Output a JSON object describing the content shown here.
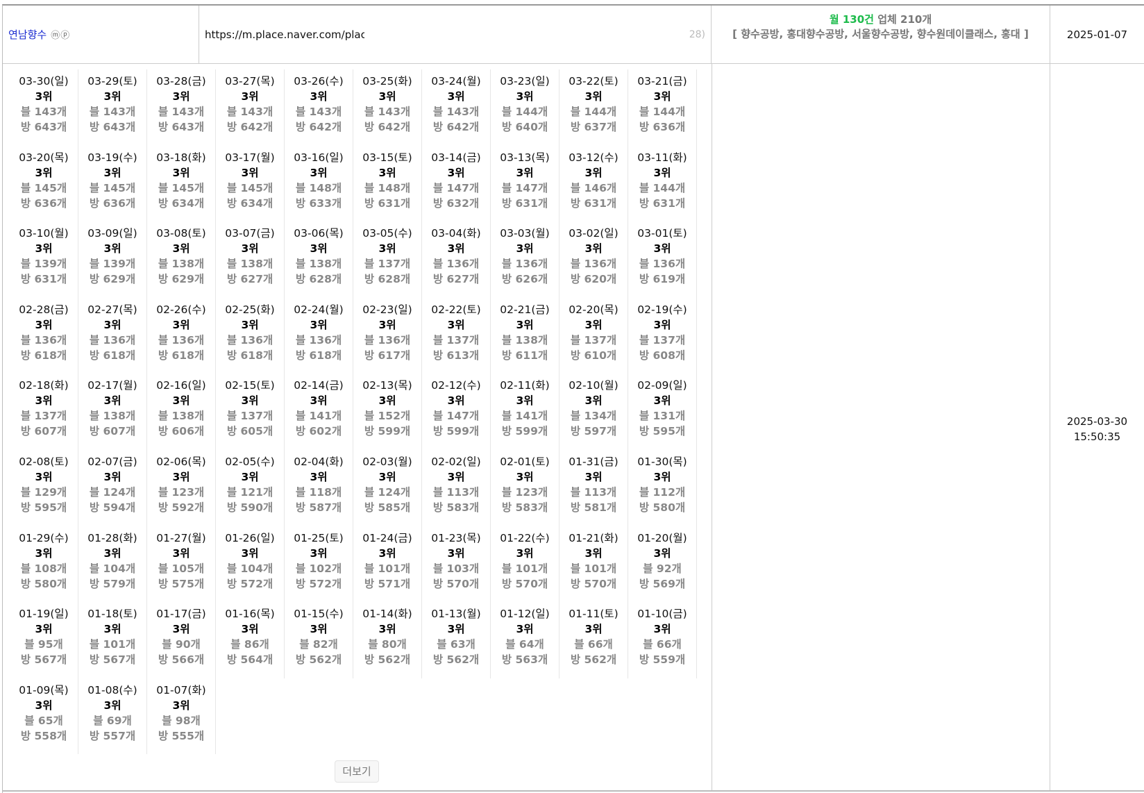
{
  "header": {
    "name": "연남향수",
    "name_badges": "ⓜⓟ",
    "url": "https://m.place.naver.com/place",
    "url_tail": "28)",
    "monthly_label": "월 130건",
    "vendors_label": "업체 210개",
    "keywords": "[ 향수공방, 홍대향수공방, 서울향수공방, 향수원데이클래스, 홍대 ]",
    "reg_date": "2025-01-07"
  },
  "timestamp": {
    "date": "2025-03-30",
    "time": "15:50:35"
  },
  "more_label": "더보기",
  "days": [
    {
      "date": "03-30(일)",
      "rank": "3위",
      "blog": "블 143개",
      "place": "방 643개"
    },
    {
      "date": "03-29(토)",
      "rank": "3위",
      "blog": "블 143개",
      "place": "방 643개"
    },
    {
      "date": "03-28(금)",
      "rank": "3위",
      "blog": "블 143개",
      "place": "방 643개"
    },
    {
      "date": "03-27(목)",
      "rank": "3위",
      "blog": "블 143개",
      "place": "방 642개"
    },
    {
      "date": "03-26(수)",
      "rank": "3위",
      "blog": "블 143개",
      "place": "방 642개"
    },
    {
      "date": "03-25(화)",
      "rank": "3위",
      "blog": "블 143개",
      "place": "방 642개"
    },
    {
      "date": "03-24(월)",
      "rank": "3위",
      "blog": "블 143개",
      "place": "방 642개"
    },
    {
      "date": "03-23(일)",
      "rank": "3위",
      "blog": "블 144개",
      "place": "방 640개"
    },
    {
      "date": "03-22(토)",
      "rank": "3위",
      "blog": "블 144개",
      "place": "방 637개"
    },
    {
      "date": "03-21(금)",
      "rank": "3위",
      "blog": "블 144개",
      "place": "방 636개"
    },
    {
      "date": "03-20(목)",
      "rank": "3위",
      "blog": "블 145개",
      "place": "방 636개"
    },
    {
      "date": "03-19(수)",
      "rank": "3위",
      "blog": "블 145개",
      "place": "방 636개"
    },
    {
      "date": "03-18(화)",
      "rank": "3위",
      "blog": "블 145개",
      "place": "방 634개"
    },
    {
      "date": "03-17(월)",
      "rank": "3위",
      "blog": "블 145개",
      "place": "방 634개"
    },
    {
      "date": "03-16(일)",
      "rank": "3위",
      "blog": "블 148개",
      "place": "방 633개"
    },
    {
      "date": "03-15(토)",
      "rank": "3위",
      "blog": "블 148개",
      "place": "방 631개"
    },
    {
      "date": "03-14(금)",
      "rank": "3위",
      "blog": "블 147개",
      "place": "방 632개"
    },
    {
      "date": "03-13(목)",
      "rank": "3위",
      "blog": "블 147개",
      "place": "방 631개"
    },
    {
      "date": "03-12(수)",
      "rank": "3위",
      "blog": "블 146개",
      "place": "방 631개"
    },
    {
      "date": "03-11(화)",
      "rank": "3위",
      "blog": "블 144개",
      "place": "방 631개"
    },
    {
      "date": "03-10(월)",
      "rank": "3위",
      "blog": "블 139개",
      "place": "방 631개"
    },
    {
      "date": "03-09(일)",
      "rank": "3위",
      "blog": "블 139개",
      "place": "방 629개"
    },
    {
      "date": "03-08(토)",
      "rank": "3위",
      "blog": "블 138개",
      "place": "방 629개"
    },
    {
      "date": "03-07(금)",
      "rank": "3위",
      "blog": "블 138개",
      "place": "방 627개"
    },
    {
      "date": "03-06(목)",
      "rank": "3위",
      "blog": "블 138개",
      "place": "방 628개"
    },
    {
      "date": "03-05(수)",
      "rank": "3위",
      "blog": "블 137개",
      "place": "방 628개"
    },
    {
      "date": "03-04(화)",
      "rank": "3위",
      "blog": "블 136개",
      "place": "방 627개"
    },
    {
      "date": "03-03(월)",
      "rank": "3위",
      "blog": "블 136개",
      "place": "방 626개"
    },
    {
      "date": "03-02(일)",
      "rank": "3위",
      "blog": "블 136개",
      "place": "방 620개"
    },
    {
      "date": "03-01(토)",
      "rank": "3위",
      "blog": "블 136개",
      "place": "방 619개"
    },
    {
      "date": "02-28(금)",
      "rank": "3위",
      "blog": "블 136개",
      "place": "방 618개"
    },
    {
      "date": "02-27(목)",
      "rank": "3위",
      "blog": "블 136개",
      "place": "방 618개"
    },
    {
      "date": "02-26(수)",
      "rank": "3위",
      "blog": "블 136개",
      "place": "방 618개"
    },
    {
      "date": "02-25(화)",
      "rank": "3위",
      "blog": "블 136개",
      "place": "방 618개"
    },
    {
      "date": "02-24(월)",
      "rank": "3위",
      "blog": "블 136개",
      "place": "방 618개"
    },
    {
      "date": "02-23(일)",
      "rank": "3위",
      "blog": "블 136개",
      "place": "방 617개"
    },
    {
      "date": "02-22(토)",
      "rank": "3위",
      "blog": "블 137개",
      "place": "방 613개"
    },
    {
      "date": "02-21(금)",
      "rank": "3위",
      "blog": "블 138개",
      "place": "방 611개"
    },
    {
      "date": "02-20(목)",
      "rank": "3위",
      "blog": "블 137개",
      "place": "방 610개"
    },
    {
      "date": "02-19(수)",
      "rank": "3위",
      "blog": "블 137개",
      "place": "방 608개"
    },
    {
      "date": "02-18(화)",
      "rank": "3위",
      "blog": "블 137개",
      "place": "방 607개"
    },
    {
      "date": "02-17(월)",
      "rank": "3위",
      "blog": "블 138개",
      "place": "방 607개"
    },
    {
      "date": "02-16(일)",
      "rank": "3위",
      "blog": "블 138개",
      "place": "방 606개"
    },
    {
      "date": "02-15(토)",
      "rank": "3위",
      "blog": "블 137개",
      "place": "방 605개"
    },
    {
      "date": "02-14(금)",
      "rank": "3위",
      "blog": "블 141개",
      "place": "방 602개"
    },
    {
      "date": "02-13(목)",
      "rank": "3위",
      "blog": "블 152개",
      "place": "방 599개"
    },
    {
      "date": "02-12(수)",
      "rank": "3위",
      "blog": "블 147개",
      "place": "방 599개"
    },
    {
      "date": "02-11(화)",
      "rank": "3위",
      "blog": "블 141개",
      "place": "방 599개"
    },
    {
      "date": "02-10(월)",
      "rank": "3위",
      "blog": "블 134개",
      "place": "방 597개"
    },
    {
      "date": "02-09(일)",
      "rank": "3위",
      "blog": "블 131개",
      "place": "방 595개"
    },
    {
      "date": "02-08(토)",
      "rank": "3위",
      "blog": "블 129개",
      "place": "방 595개"
    },
    {
      "date": "02-07(금)",
      "rank": "3위",
      "blog": "블 124개",
      "place": "방 594개"
    },
    {
      "date": "02-06(목)",
      "rank": "3위",
      "blog": "블 123개",
      "place": "방 592개"
    },
    {
      "date": "02-05(수)",
      "rank": "3위",
      "blog": "블 121개",
      "place": "방 590개"
    },
    {
      "date": "02-04(화)",
      "rank": "3위",
      "blog": "블 118개",
      "place": "방 587개"
    },
    {
      "date": "02-03(월)",
      "rank": "3위",
      "blog": "블 124개",
      "place": "방 585개"
    },
    {
      "date": "02-02(일)",
      "rank": "3위",
      "blog": "블 113개",
      "place": "방 583개"
    },
    {
      "date": "02-01(토)",
      "rank": "3위",
      "blog": "블 123개",
      "place": "방 583개"
    },
    {
      "date": "01-31(금)",
      "rank": "3위",
      "blog": "블 113개",
      "place": "방 581개"
    },
    {
      "date": "01-30(목)",
      "rank": "3위",
      "blog": "블 112개",
      "place": "방 580개"
    },
    {
      "date": "01-29(수)",
      "rank": "3위",
      "blog": "블 108개",
      "place": "방 580개"
    },
    {
      "date": "01-28(화)",
      "rank": "3위",
      "blog": "블 104개",
      "place": "방 579개"
    },
    {
      "date": "01-27(월)",
      "rank": "3위",
      "blog": "블 105개",
      "place": "방 575개"
    },
    {
      "date": "01-26(일)",
      "rank": "3위",
      "blog": "블 104개",
      "place": "방 572개"
    },
    {
      "date": "01-25(토)",
      "rank": "3위",
      "blog": "블 102개",
      "place": "방 572개"
    },
    {
      "date": "01-24(금)",
      "rank": "3위",
      "blog": "블 101개",
      "place": "방 571개"
    },
    {
      "date": "01-23(목)",
      "rank": "3위",
      "blog": "블 103개",
      "place": "방 570개"
    },
    {
      "date": "01-22(수)",
      "rank": "3위",
      "blog": "블 101개",
      "place": "방 570개"
    },
    {
      "date": "01-21(화)",
      "rank": "3위",
      "blog": "블 101개",
      "place": "방 570개"
    },
    {
      "date": "01-20(월)",
      "rank": "3위",
      "blog": "블 92개",
      "place": "방 569개"
    },
    {
      "date": "01-19(일)",
      "rank": "3위",
      "blog": "블 95개",
      "place": "방 567개"
    },
    {
      "date": "01-18(토)",
      "rank": "3위",
      "blog": "블 101개",
      "place": "방 567개"
    },
    {
      "date": "01-17(금)",
      "rank": "3위",
      "blog": "블 90개",
      "place": "방 566개"
    },
    {
      "date": "01-16(목)",
      "rank": "3위",
      "blog": "블 86개",
      "place": "방 564개"
    },
    {
      "date": "01-15(수)",
      "rank": "3위",
      "blog": "블 82개",
      "place": "방 562개"
    },
    {
      "date": "01-14(화)",
      "rank": "3위",
      "blog": "블 80개",
      "place": "방 562개"
    },
    {
      "date": "01-13(월)",
      "rank": "3위",
      "blog": "블 63개",
      "place": "방 562개"
    },
    {
      "date": "01-12(일)",
      "rank": "3위",
      "blog": "블 64개",
      "place": "방 563개"
    },
    {
      "date": "01-11(토)",
      "rank": "3위",
      "blog": "블 66개",
      "place": "방 562개"
    },
    {
      "date": "01-10(금)",
      "rank": "3위",
      "blog": "블 66개",
      "place": "방 559개"
    },
    {
      "date": "01-09(목)",
      "rank": "3위",
      "blog": "블 65개",
      "place": "방 558개"
    },
    {
      "date": "01-08(수)",
      "rank": "3위",
      "blog": "블 69개",
      "place": "방 557개"
    },
    {
      "date": "01-07(화)",
      "rank": "3위",
      "blog": "블 98개",
      "place": "방 555개"
    }
  ]
}
